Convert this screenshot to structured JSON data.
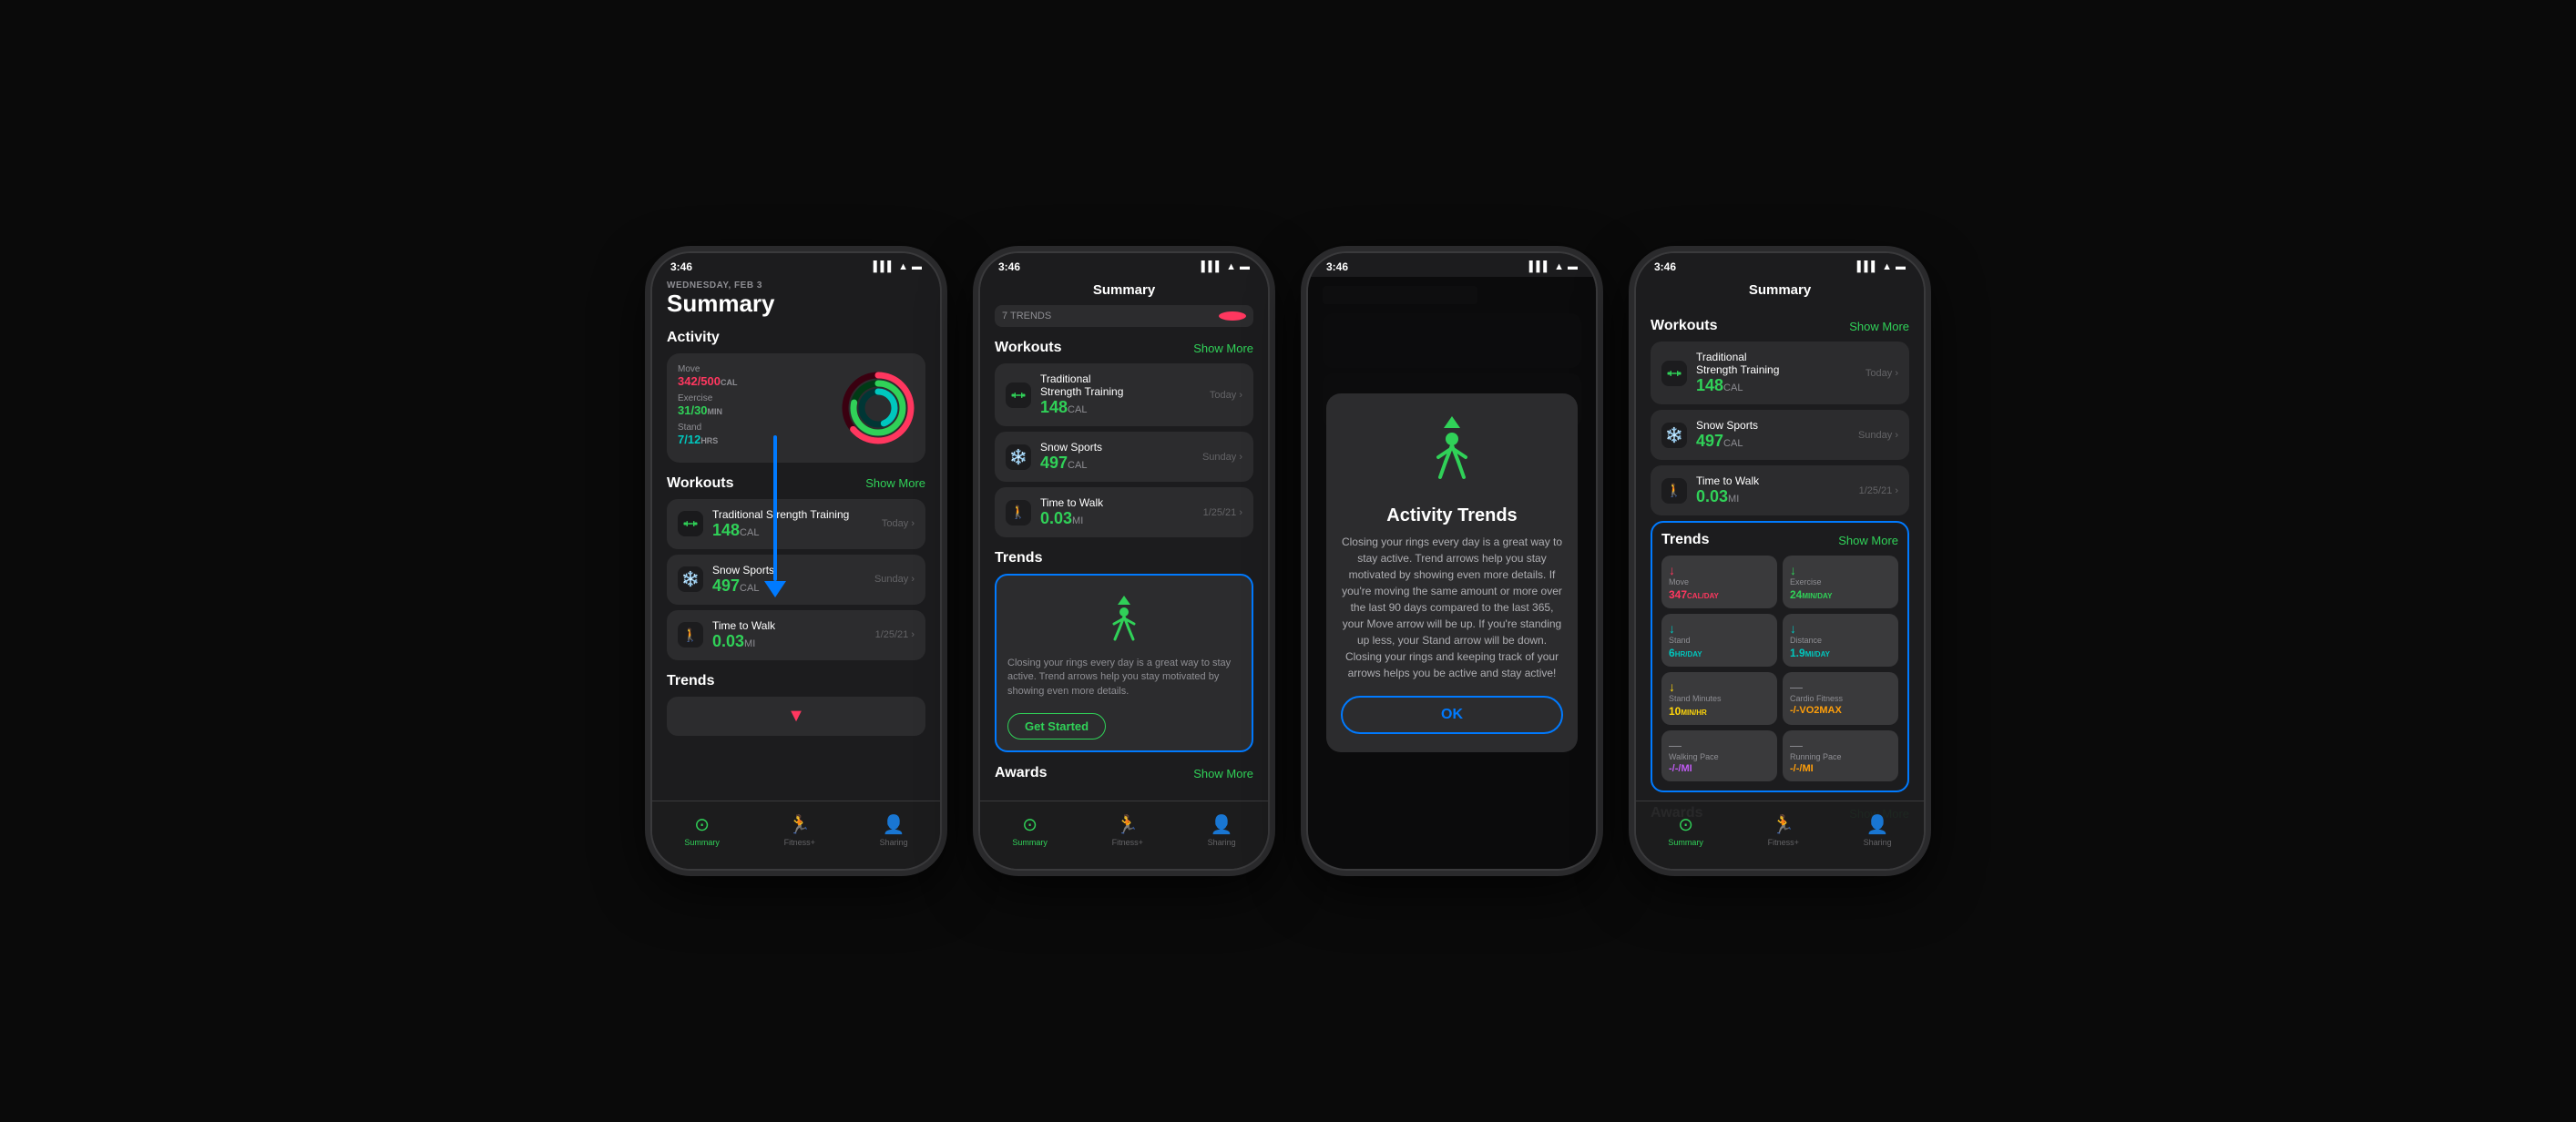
{
  "phones": [
    {
      "id": "phone1",
      "status": {
        "time": "3:46",
        "signal": "●●●",
        "wifi": "WiFi",
        "battery": "🔋"
      },
      "date": "WEDNESDAY, FEB 3",
      "title": "Summary",
      "activity": {
        "section": "Activity",
        "move": {
          "label": "Move",
          "value": "342/500",
          "unit": "CAL"
        },
        "exercise": {
          "label": "Exercise",
          "value": "31/30",
          "unit": "MIN"
        },
        "stand": {
          "label": "Stand",
          "value": "7/12",
          "unit": "HRS"
        }
      },
      "workouts": {
        "section": "Workouts",
        "show_more": "Show More",
        "items": [
          {
            "name": "Traditional Strength Training",
            "cal": "148",
            "unit": "CAL",
            "date": "Today"
          },
          {
            "name": "Snow Sports",
            "cal": "497",
            "unit": "CAL",
            "date": "Sunday"
          },
          {
            "name": "Time to Walk",
            "cal": "0.03",
            "unit": "MI",
            "date": "1/25/21"
          }
        ]
      },
      "trends": {
        "section": "Trends"
      },
      "nav": [
        {
          "label": "Summary",
          "active": true
        },
        {
          "label": "Fitness+",
          "active": false
        },
        {
          "label": "Sharing",
          "active": false
        }
      ]
    },
    {
      "id": "phone2",
      "status": {
        "time": "3:46",
        "signal": "●●●",
        "wifi": "WiFi",
        "battery": "🔋"
      },
      "nav_title": "Summary",
      "workouts": {
        "section": "Workouts",
        "show_more": "Show More",
        "items": [
          {
            "name": "Traditional Strength Training",
            "cal": "148",
            "unit": "CAL",
            "date": "Today"
          },
          {
            "name": "Snow Sports",
            "cal": "497",
            "unit": "CAL",
            "date": "Sunday"
          },
          {
            "name": "Time to Walk",
            "cal": "0.03",
            "unit": "MI",
            "date": "1/25/21"
          }
        ]
      },
      "trends": {
        "section": "Trends",
        "desc": "Closing your rings every day is a great way to stay active. Trend arrows help you stay motivated by showing even more details.",
        "btn": "Get Started"
      },
      "awards": {
        "section": "Awards",
        "show_more": "Show More"
      },
      "nav": [
        {
          "label": "Summary",
          "active": true
        },
        {
          "label": "Fitness+",
          "active": false
        },
        {
          "label": "Sharing",
          "active": false
        }
      ]
    },
    {
      "id": "phone3",
      "status": {
        "time": "3:46",
        "signal": "●●●",
        "wifi": "WiFi",
        "battery": "🔋"
      },
      "modal": {
        "title": "Activity Trends",
        "text": "Closing your rings every day is a great way to stay active. Trend arrows help you stay motivated by showing even more details. If you're moving the same amount or more over the last 90 days compared to the last 365, your Move arrow will be up. If you're standing up less, your Stand arrow will be down. Closing your rings and keeping track of your arrows helps you be active and stay active!",
        "ok": "OK"
      }
    },
    {
      "id": "phone4",
      "status": {
        "time": "3:46",
        "signal": "●●●",
        "wifi": "WiFi",
        "battery": "🔋"
      },
      "nav_title": "Summary",
      "workouts": {
        "section": "Workouts",
        "show_more": "Show More",
        "items": [
          {
            "name": "Traditional Strength Training",
            "cal": "148",
            "unit": "CAL",
            "date": "Today"
          },
          {
            "name": "Snow Sports",
            "cal": "497",
            "unit": "CAL",
            "date": "Sunday"
          },
          {
            "name": "Time to Walk",
            "cal": "0.03",
            "unit": "MI",
            "date": "1/25/21"
          }
        ]
      },
      "trends": {
        "section": "Trends",
        "show_more": "Show More",
        "items": [
          {
            "label": "Move",
            "value": "347CAL/DAY",
            "color": "red",
            "arrow": "↓"
          },
          {
            "label": "Exercise",
            "value": "24MIN/DAY",
            "color": "green",
            "arrow": "↓"
          },
          {
            "label": "Stand",
            "value": "6HR/DAY",
            "color": "teal",
            "arrow": "↓"
          },
          {
            "label": "Distance",
            "value": "1.9MI/DAY",
            "color": "teal",
            "arrow": "↓"
          },
          {
            "label": "Stand Minutes",
            "value": "10MIN/HR",
            "color": "yellow",
            "arrow": "↓"
          },
          {
            "label": "Cardio Fitness",
            "value": "-/-VO2MAX",
            "color": "orange",
            "arrow": "-"
          },
          {
            "label": "Walking Pace",
            "value": "-/-/MI",
            "color": "purple",
            "arrow": "-"
          },
          {
            "label": "Running Pace",
            "value": "-/-/MI",
            "color": "orange",
            "arrow": "-"
          }
        ]
      },
      "awards": {
        "section": "Awards",
        "show_more": "Show More"
      },
      "nav": [
        {
          "label": "Summary",
          "active": true
        },
        {
          "label": "Fitness+",
          "active": false
        },
        {
          "label": "Sharing",
          "active": false
        }
      ]
    }
  ]
}
